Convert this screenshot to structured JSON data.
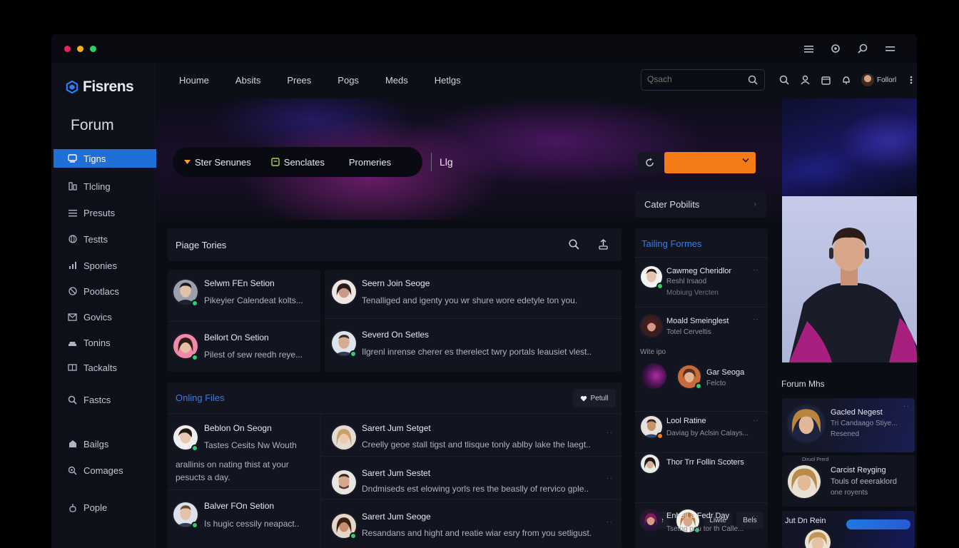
{
  "window": {
    "controls": {
      "close_color": "#e0245e",
      "min_color": "#f2b01e",
      "max_color": "#2ccf6a"
    },
    "right_icons": [
      "menu-icon",
      "settings-icon",
      "search-icon",
      "hamburger-icon"
    ]
  },
  "brand": {
    "name": "Fisrens",
    "accent": "#1f6fd6"
  },
  "sidebar": {
    "title": "Forum",
    "items": [
      {
        "label": "Tigns",
        "icon": "topics-icon",
        "active": true
      },
      {
        "label": "Tlcling",
        "icon": "trending-icon"
      },
      {
        "label": "Presuts",
        "icon": "list-icon"
      },
      {
        "label": "Testts",
        "icon": "globe-icon"
      },
      {
        "label": "Sponies",
        "icon": "chart-icon"
      },
      {
        "label": "Pootlacs",
        "icon": "badge-icon"
      },
      {
        "label": "Govics",
        "icon": "mail-icon"
      },
      {
        "label": "Tonins",
        "icon": "car-icon"
      },
      {
        "label": "Tackalts",
        "icon": "people-icon"
      },
      {
        "label": "Fastcs",
        "icon": "search-icon"
      },
      {
        "label": "Bailgs",
        "icon": "home-icon"
      },
      {
        "label": "Comages",
        "icon": "zoom-icon"
      },
      {
        "label": "Pople",
        "icon": "lock-icon"
      }
    ]
  },
  "topnav": {
    "links": [
      "Houme",
      "Absits",
      "Prees",
      "Pogs",
      "Meds",
      "Hetlgs"
    ],
    "search_placeholder": "Qsach",
    "user_name": "Follorl"
  },
  "hero": {
    "pill_items": [
      "Ster Senunes",
      "Senclates",
      "Promeries"
    ],
    "extra": "Llg",
    "cater_label": "Cater Pobilits"
  },
  "page_topics": {
    "title": "Piage Tories",
    "posts": [
      {
        "title": "Selwm FEn Setion",
        "text": "Pikeyier Calendeat kolts..."
      },
      {
        "title": "Seern Join Seoge",
        "text": "Tenalliged and igenty you wr shure wore edetyle ton you."
      },
      {
        "title": "Bellort On Setion",
        "text": "Pilest of sew reedh reye..."
      },
      {
        "title": "Severd On Setles",
        "text": "Ilgrenl inrense cherer es therelect twry portals leausiet vlest.."
      }
    ]
  },
  "online_files": {
    "title": "Onling Files",
    "button_label": "Petull",
    "posts": [
      {
        "title": "Beblon On Seogn",
        "text": "Tastes Cesits Nw Wouth",
        "text2": "arallinis on nating thist at your",
        "text3": "pesucts a day."
      },
      {
        "title": "Sarert Jum Setget",
        "text": "Creelly geoe stall tigst and tlisque tonly ablby lake the laegt.."
      },
      {
        "title": "Sarert Jum Sestet",
        "text": "Dndmiseds est elowing yorls res the beaslly of rervico gple.."
      },
      {
        "title": "Balver FOn Setion",
        "text": "Is hugic cessily neapact.."
      },
      {
        "title": "Sarert Jum Seoge",
        "text": "Resandans and hight and reatie wiar esry from you setligust."
      }
    ]
  },
  "trending": {
    "title": "Tailing Formes",
    "items": [
      {
        "title": "Cawmeg Cheridlor",
        "sub": "Reshl Irsaod",
        "sub2": "Mobiurg Vercten"
      },
      {
        "title": "Moald Smeinglest",
        "sub": "Totel Cerveltis"
      },
      {
        "label": "Wite ipo"
      },
      {
        "title": "Gar Seoga",
        "sub": "Felcto"
      },
      {
        "title": "Lool Ratine",
        "sub": "Daviag by Aclsin Calays..."
      },
      {
        "title": "Thor Trr Follin Scoters"
      },
      {
        "title": "Enbell a Fedr Day",
        "sub": "Tsetng pou tor th Calle..."
      }
    ],
    "tags": [
      "Elare",
      "Liwte",
      "Bels"
    ]
  },
  "forum_right": {
    "title": "Forum Mhs",
    "cards": [
      {
        "title": "Gacled Negest",
        "sub": "Tri Candaago Stiye...",
        "sub2": "Resened"
      },
      {
        "head": "Diruol Prerd",
        "title": "Carcist Reyging",
        "sub": "Touls of eeeraklord",
        "sub2": "one royents"
      },
      {
        "title": "Jut Dn Rein"
      }
    ]
  }
}
